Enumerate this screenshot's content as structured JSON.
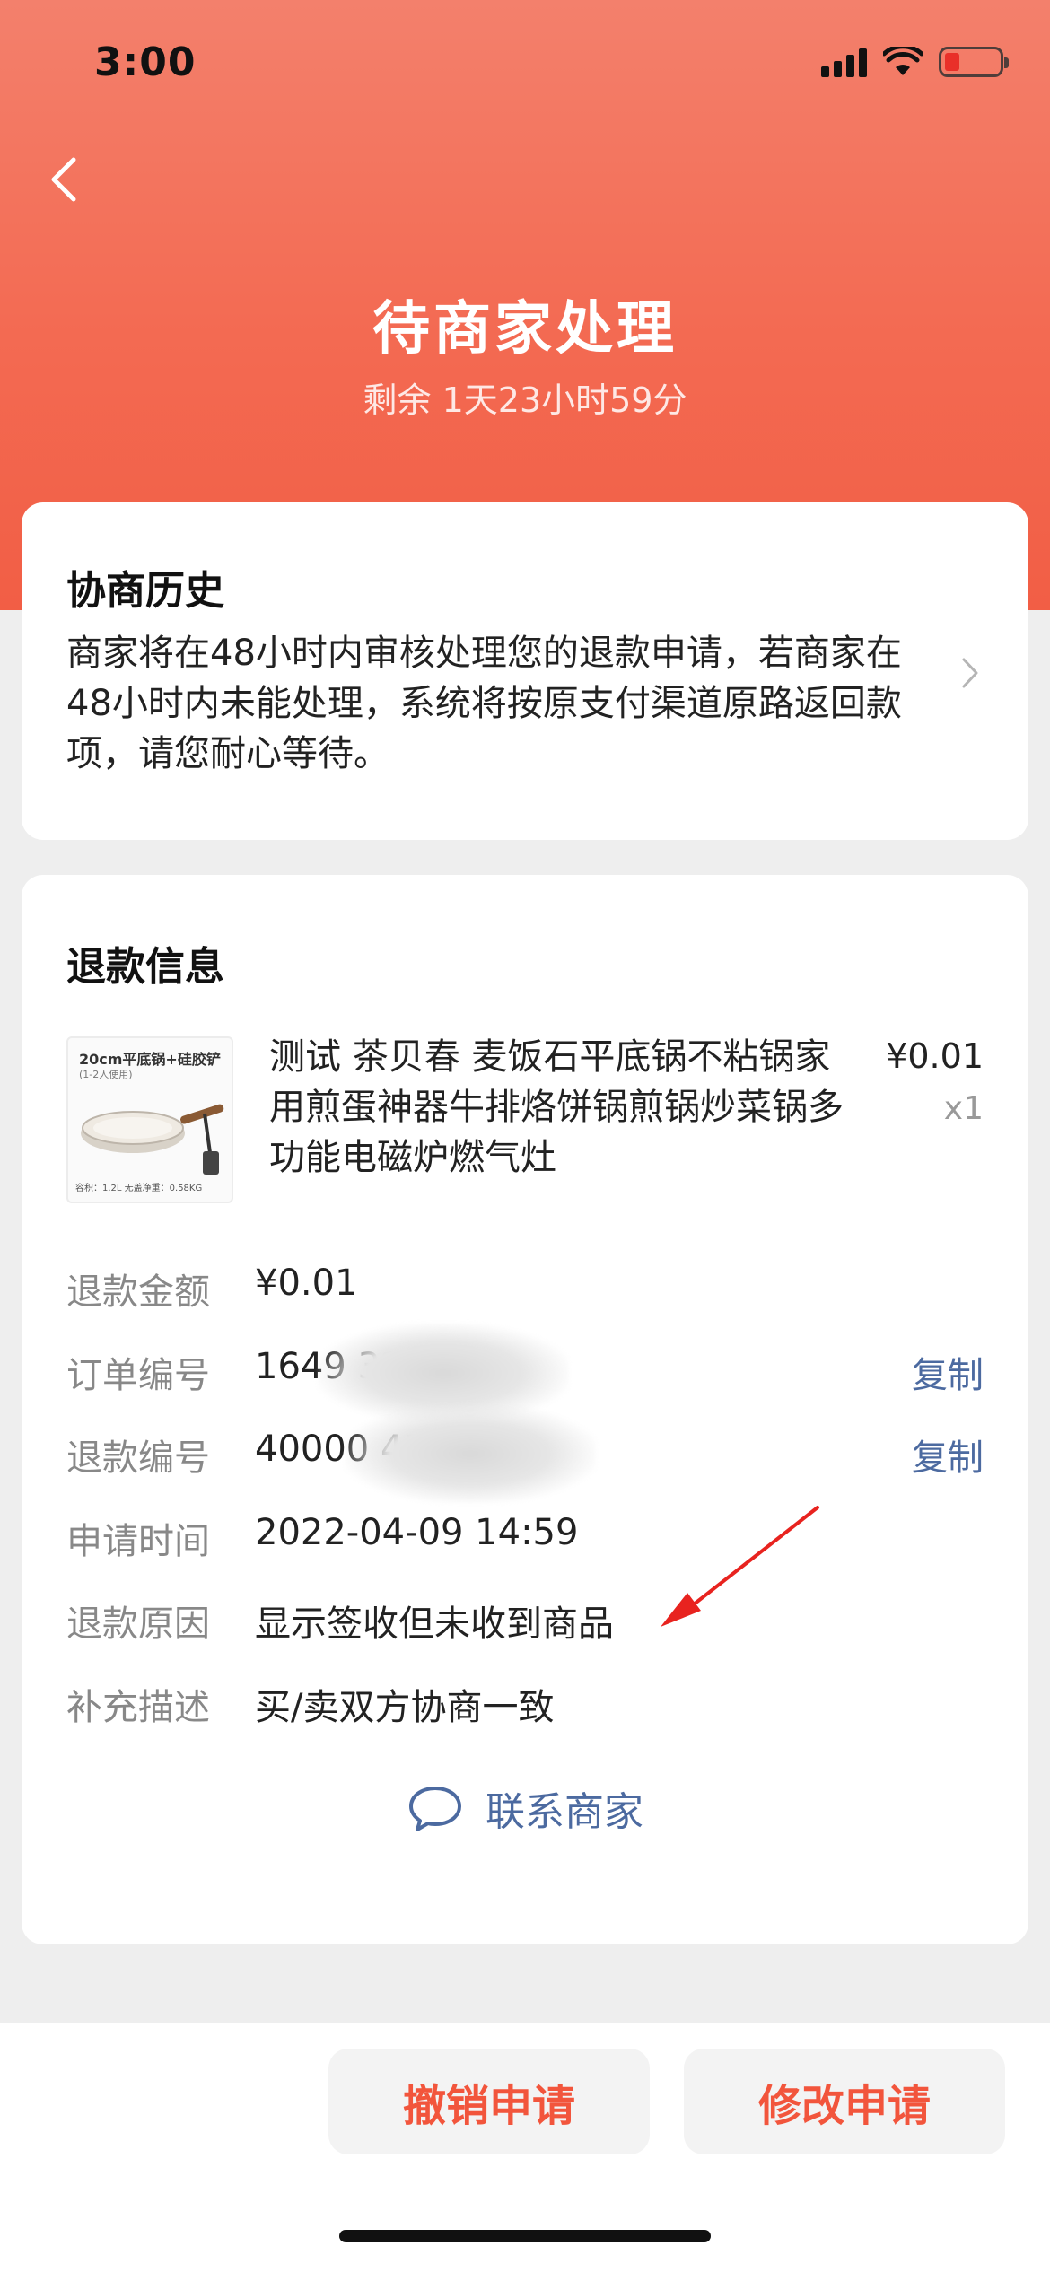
{
  "status_bar": {
    "time": "3:00"
  },
  "header": {
    "title": "待商家处理",
    "subtitle": "剩余 1天23小时59分"
  },
  "history": {
    "title": "协商历史",
    "text": "商家将在48小时内审核处理您的退款申请，若商家在48小时内未能处理，系统将按原支付渠道原路返回款项，请您耐心等待。"
  },
  "refund": {
    "title": "退款信息",
    "product": {
      "name": "测试 茶贝春 麦饭石平底锅不粘锅家用煎蛋神器牛排烙饼锅煎锅炒菜锅多功能电磁炉燃气灶",
      "price": "¥0.01",
      "qty": "x1",
      "thumb_title": "20cm平底锅+硅胶铲",
      "thumb_sub": "(1-2人使用)",
      "thumb_foot": "容积：1.2L   无盖净重：0.58KG"
    },
    "rows": [
      {
        "label": "退款金额",
        "value": "¥0.01"
      },
      {
        "label": "订单编号",
        "value": "1649          321000",
        "action": "复制"
      },
      {
        "label": "退款编号",
        "value": "40000           43",
        "action": "复制"
      },
      {
        "label": "申请时间",
        "value": "2022-04-09 14:59"
      },
      {
        "label": "退款原因",
        "value": "显示签收但未收到商品"
      },
      {
        "label": "补充描述",
        "value": "买/卖双方协商一致"
      }
    ],
    "contact_label": "联系商家"
  },
  "actions": {
    "cancel": "撤销申请",
    "modify": "修改申请"
  },
  "colors": {
    "accent": "#f2553c",
    "link": "#4c6aa0",
    "annotation_arrow": "#e8231f"
  }
}
